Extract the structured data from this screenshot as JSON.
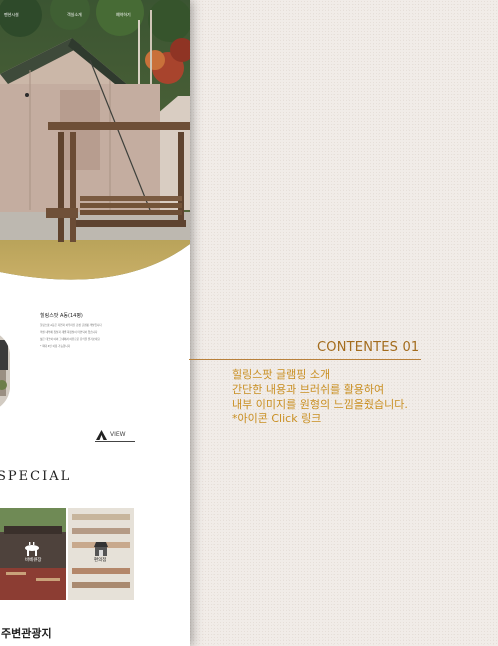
{
  "nav": {
    "items": [
      "펜션시설",
      "객실소개",
      "예약하기"
    ]
  },
  "room": {
    "title": "힐링스팟 A동(14평)",
    "lines": [
      "힐링스팟 A동은 자연과 어우러진 감성 글램핑 객실입니다",
      "객실 내부에 침실과 개별 화장실이 마련되어 있습니다",
      "넓은 데크와 야외 그네에서 여유로운 휴식을 즐겨보세요",
      "* 최대 4인 이용 가능합니다"
    ],
    "view_label": "VIEW"
  },
  "special": {
    "title": "SPECIAL"
  },
  "tiles": [
    {
      "label": "바베큐장"
    },
    {
      "label": "편의점"
    }
  ],
  "tour": {
    "title": "주변관광지"
  },
  "annotation": {
    "title": "CONTENTES 01",
    "lines": [
      "힐링스팟  글램핑 소개",
      "간단한 내용과 브러쉬를 활용하여",
      "내부 이미지를 원형의 느낌을줬습니다.",
      "*아이콘 Click 링크"
    ]
  },
  "colors": {
    "accent": "#c98f22",
    "accent_dark": "#a36c1d",
    "background": "#f1ece8"
  }
}
